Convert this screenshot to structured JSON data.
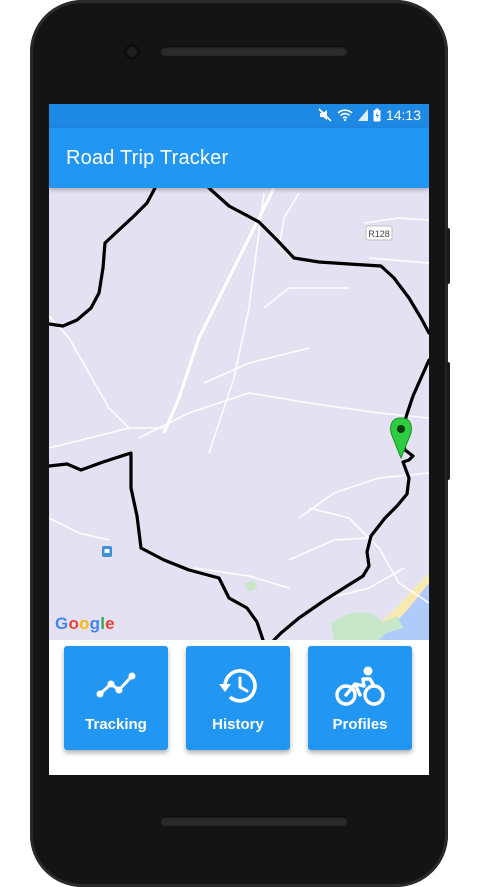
{
  "status_bar": {
    "time": "14:13",
    "icons": [
      "mute-icon",
      "wifi-icon",
      "signal-icon",
      "battery-icon"
    ]
  },
  "app_bar": {
    "title": "Road Trip Tracker",
    "color": "#2196F3"
  },
  "map": {
    "road_label": "R128",
    "attribution": "Google",
    "marker_color": "#2ECC40",
    "route_color": "#000000"
  },
  "nav_buttons": [
    {
      "label": "Tracking",
      "icon": "tracking-icon"
    },
    {
      "label": "History",
      "icon": "history-icon"
    },
    {
      "label": "Profiles",
      "icon": "cyclist-icon"
    }
  ]
}
